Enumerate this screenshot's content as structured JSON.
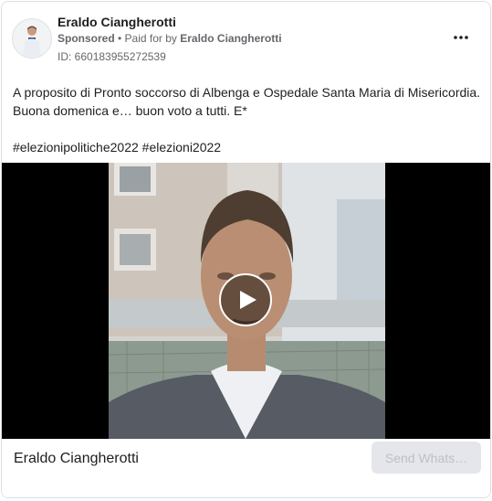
{
  "ad": {
    "advertiser": "Eraldo Ciangherotti",
    "sponsored_label": "Sponsored",
    "separator": " • ",
    "paid_for_prefix": "Paid for by ",
    "paid_for_by": "Eraldo Ciangherotti",
    "id_text": "ID: 660183955272539",
    "more_icon": "more-horizontal-icon"
  },
  "body": {
    "line1": "A proposito di Pronto soccorso di Albenga e Ospedale Santa Maria di Misericordia. Buona domenica e… buon voto a tutti. E*",
    "hashtags": "#elezionipolitiche2022 #elezioni2022"
  },
  "media": {
    "type": "video",
    "play_icon": "play-icon"
  },
  "footer": {
    "page_name": "Eraldo Ciangherotti",
    "cta_label": "Send Whats…"
  },
  "colors": {
    "text": "#1c1e21",
    "secondary": "#65676b",
    "cta_bg": "#e4e6eb",
    "cta_text": "#bcc0c4"
  }
}
